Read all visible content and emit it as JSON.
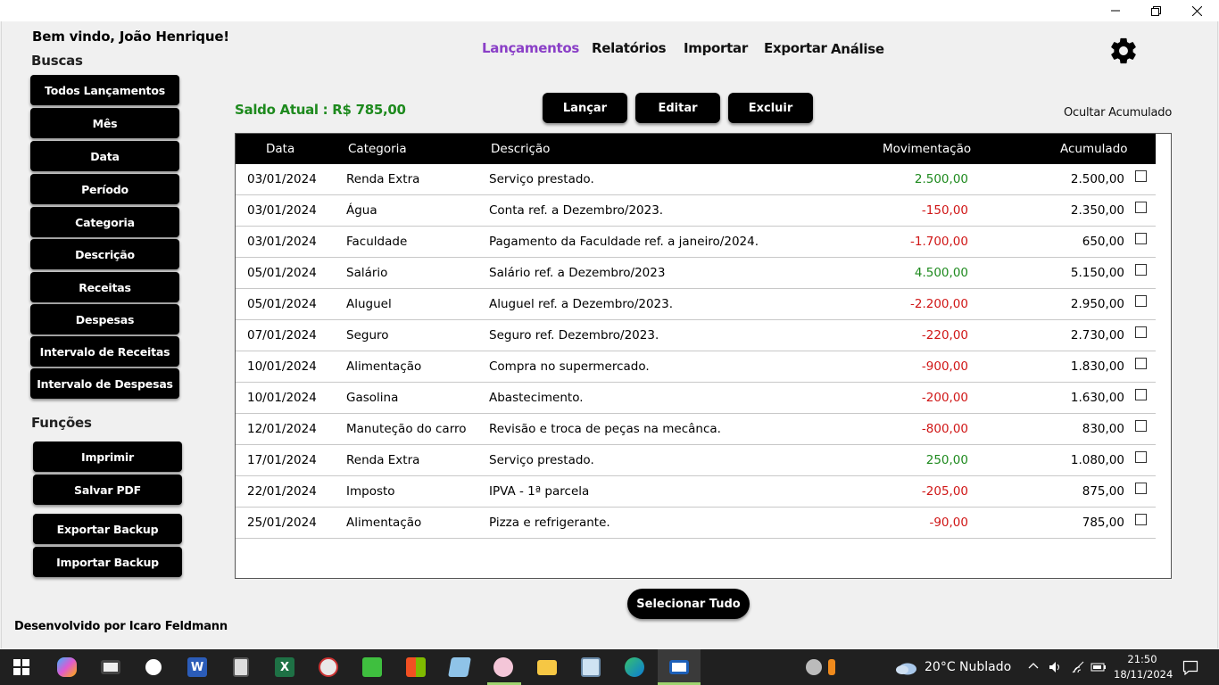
{
  "welcome": "Bem vindo, João Henrique!",
  "searches": {
    "title": "Buscas",
    "items": [
      "Todos Lançamentos",
      "Mês",
      "Data",
      "Período",
      "Categoria",
      "Descrição",
      "Receitas",
      "Despesas",
      "Intervalo de Receitas",
      "Intervalo de Despesas"
    ]
  },
  "functions": {
    "title": "Funções",
    "items": [
      "Imprimir",
      "Salvar PDF",
      "Exportar Backup",
      "Importar Backup"
    ]
  },
  "nav": {
    "items": [
      "Lançamentos",
      "Relatórios",
      "Importar",
      "Exportar",
      "Análise"
    ],
    "active": "Lançamentos"
  },
  "balance": "Saldo Atual : R$ 785,00",
  "actions": [
    "Lançar",
    "Editar",
    "Excluir"
  ],
  "toggle_accumulated": "Ocultar Acumulado",
  "table": {
    "headers": [
      "Data",
      "Categoria",
      "Descrição",
      "Movimentação",
      "Acumulado"
    ],
    "rows": [
      {
        "date": "03/01/2024",
        "category": "Renda Extra",
        "description": "Serviço prestado.",
        "movement": "2.500,00",
        "accumulated": "2.500,00",
        "type": "pos"
      },
      {
        "date": "03/01/2024",
        "category": "Água",
        "description": "Conta ref. a Dezembro/2023.",
        "movement": "-150,00",
        "accumulated": "2.350,00",
        "type": "neg"
      },
      {
        "date": "03/01/2024",
        "category": "Faculdade",
        "description": "Pagamento da Faculdade ref.  a janeiro/2024.",
        "movement": "-1.700,00",
        "accumulated": "650,00",
        "type": "neg"
      },
      {
        "date": "05/01/2024",
        "category": "Salário",
        "description": "Salário ref. a Dezembro/2023",
        "movement": "4.500,00",
        "accumulated": "5.150,00",
        "type": "pos"
      },
      {
        "date": "05/01/2024",
        "category": "Aluguel",
        "description": "Aluguel ref. a Dezembro/2023.",
        "movement": "-2.200,00",
        "accumulated": "2.950,00",
        "type": "neg"
      },
      {
        "date": "07/01/2024",
        "category": "Seguro",
        "description": "Seguro ref. Dezembro/2023.",
        "movement": "-220,00",
        "accumulated": "2.730,00",
        "type": "neg"
      },
      {
        "date": "10/01/2024",
        "category": "Alimentação",
        "description": "Compra no supermercado.",
        "movement": "-900,00",
        "accumulated": "1.830,00",
        "type": "neg"
      },
      {
        "date": "10/01/2024",
        "category": "Gasolina",
        "description": "Abastecimento.",
        "movement": "-200,00",
        "accumulated": "1.630,00",
        "type": "neg"
      },
      {
        "date": "12/01/2024",
        "category": "Manuteção do carro",
        "description": "Revisão e troca de peças na mecânca.",
        "movement": "-800,00",
        "accumulated": "830,00",
        "type": "neg"
      },
      {
        "date": "17/01/2024",
        "category": "Renda Extra",
        "description": "Serviço prestado.",
        "movement": "250,00",
        "accumulated": "1.080,00",
        "type": "pos"
      },
      {
        "date": "22/01/2024",
        "category": "Imposto",
        "description": "IPVA - 1ª parcela",
        "movement": "-205,00",
        "accumulated": "875,00",
        "type": "neg"
      },
      {
        "date": "25/01/2024",
        "category": "Alimentação",
        "description": "Pizza e refrigerante.",
        "movement": "-90,00",
        "accumulated": "785,00",
        "type": "neg"
      }
    ]
  },
  "select_all": "Selecionar Tudo",
  "credit": "Desenvolvido por Icaro Feldmann",
  "taskbar": {
    "weather": "20°C  Nublado",
    "time": "21:50",
    "date": "18/11/2024",
    "icons": [
      "windows-start",
      "copilot",
      "camera",
      "photos",
      "word",
      "calculator",
      "excel",
      "clock-app",
      "green-app",
      "store",
      "notes",
      "paint",
      "file-explorer",
      "task-manager",
      "edge",
      "active-window",
      "security",
      "updates"
    ]
  },
  "colors": {
    "accent": "#8a3fc7",
    "positive": "#1e8a1e",
    "negative": "#d01616",
    "button": "#000000"
  }
}
